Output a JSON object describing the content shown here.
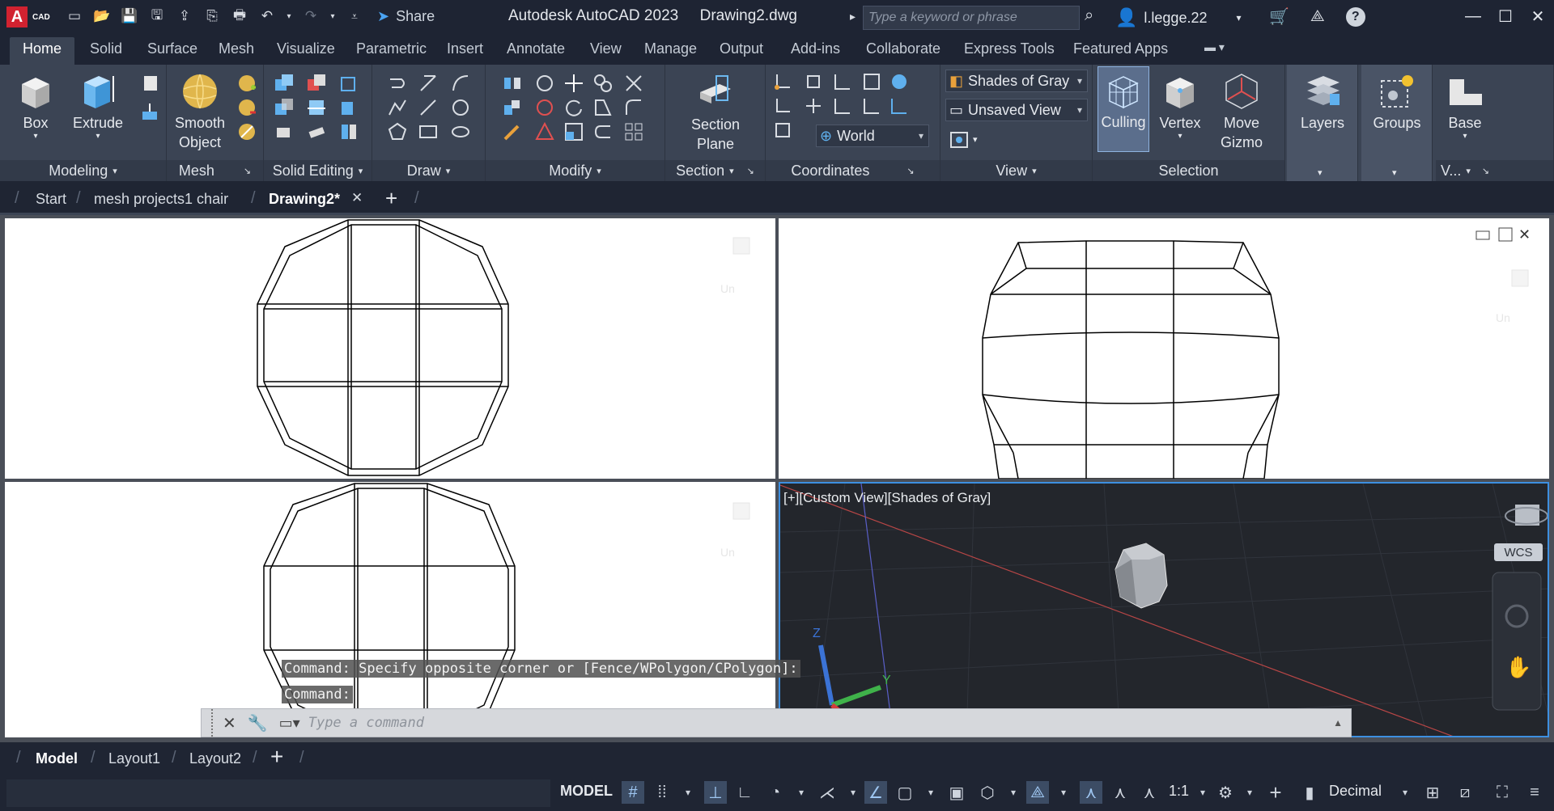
{
  "app": {
    "logo_letter": "A",
    "logo_text": "CAD",
    "title": "Autodesk AutoCAD 2023",
    "file": "Drawing2.dwg"
  },
  "qat": {
    "share": "Share"
  },
  "search": {
    "placeholder": "Type a keyword or phrase"
  },
  "user": {
    "name": "l.legge.22"
  },
  "ribbon_tabs": [
    "Home",
    "Solid",
    "Surface",
    "Mesh",
    "Visualize",
    "Parametric",
    "Insert",
    "Annotate",
    "View",
    "Manage",
    "Output",
    "Add-ins",
    "Collaborate",
    "Express Tools",
    "Featured Apps"
  ],
  "ribbon": {
    "box": "Box",
    "extrude": "Extrude",
    "smooth1": "Smooth",
    "smooth2": "Object",
    "section1": "Section",
    "section2": "Plane",
    "culling": "Culling",
    "vertex": "Vertex",
    "move1": "Move",
    "move2": "Gizmo",
    "layers": "Layers",
    "groups": "Groups",
    "base": "Base",
    "visual_style": "Shades of Gray",
    "named_view": "Unsaved View",
    "ucs": "World",
    "panels": {
      "modeling": "Modeling",
      "mesh": "Mesh",
      "solid_editing": "Solid Editing",
      "draw": "Draw",
      "modify": "Modify",
      "section": "Section",
      "coordinates": "Coordinates",
      "view": "View",
      "selection": "Selection",
      "v": "V..."
    }
  },
  "doc_tabs": {
    "start": "Start",
    "tab1": "mesh projects1 chair",
    "tab2": "Drawing2*"
  },
  "viewport": {
    "label": "[+][Custom View][Shades of Gray]",
    "wcs": "WCS",
    "faded_un": "Un"
  },
  "command": {
    "history1": "Command: Specify opposite corner or [Fence/WPolygon/CPolygon]:",
    "history2": "Command:",
    "placeholder": "Type a command"
  },
  "layout_tabs": {
    "model": "Model",
    "layout1": "Layout1",
    "layout2": "Layout2"
  },
  "statusbar": {
    "model": "MODEL",
    "scale": "1:1",
    "units": "Decimal"
  },
  "colors": {
    "accent": "#3d8fe0",
    "dark_bg": "#1f2533",
    "ribbon_bg": "#3b4454",
    "logo_red": "#d12230"
  }
}
